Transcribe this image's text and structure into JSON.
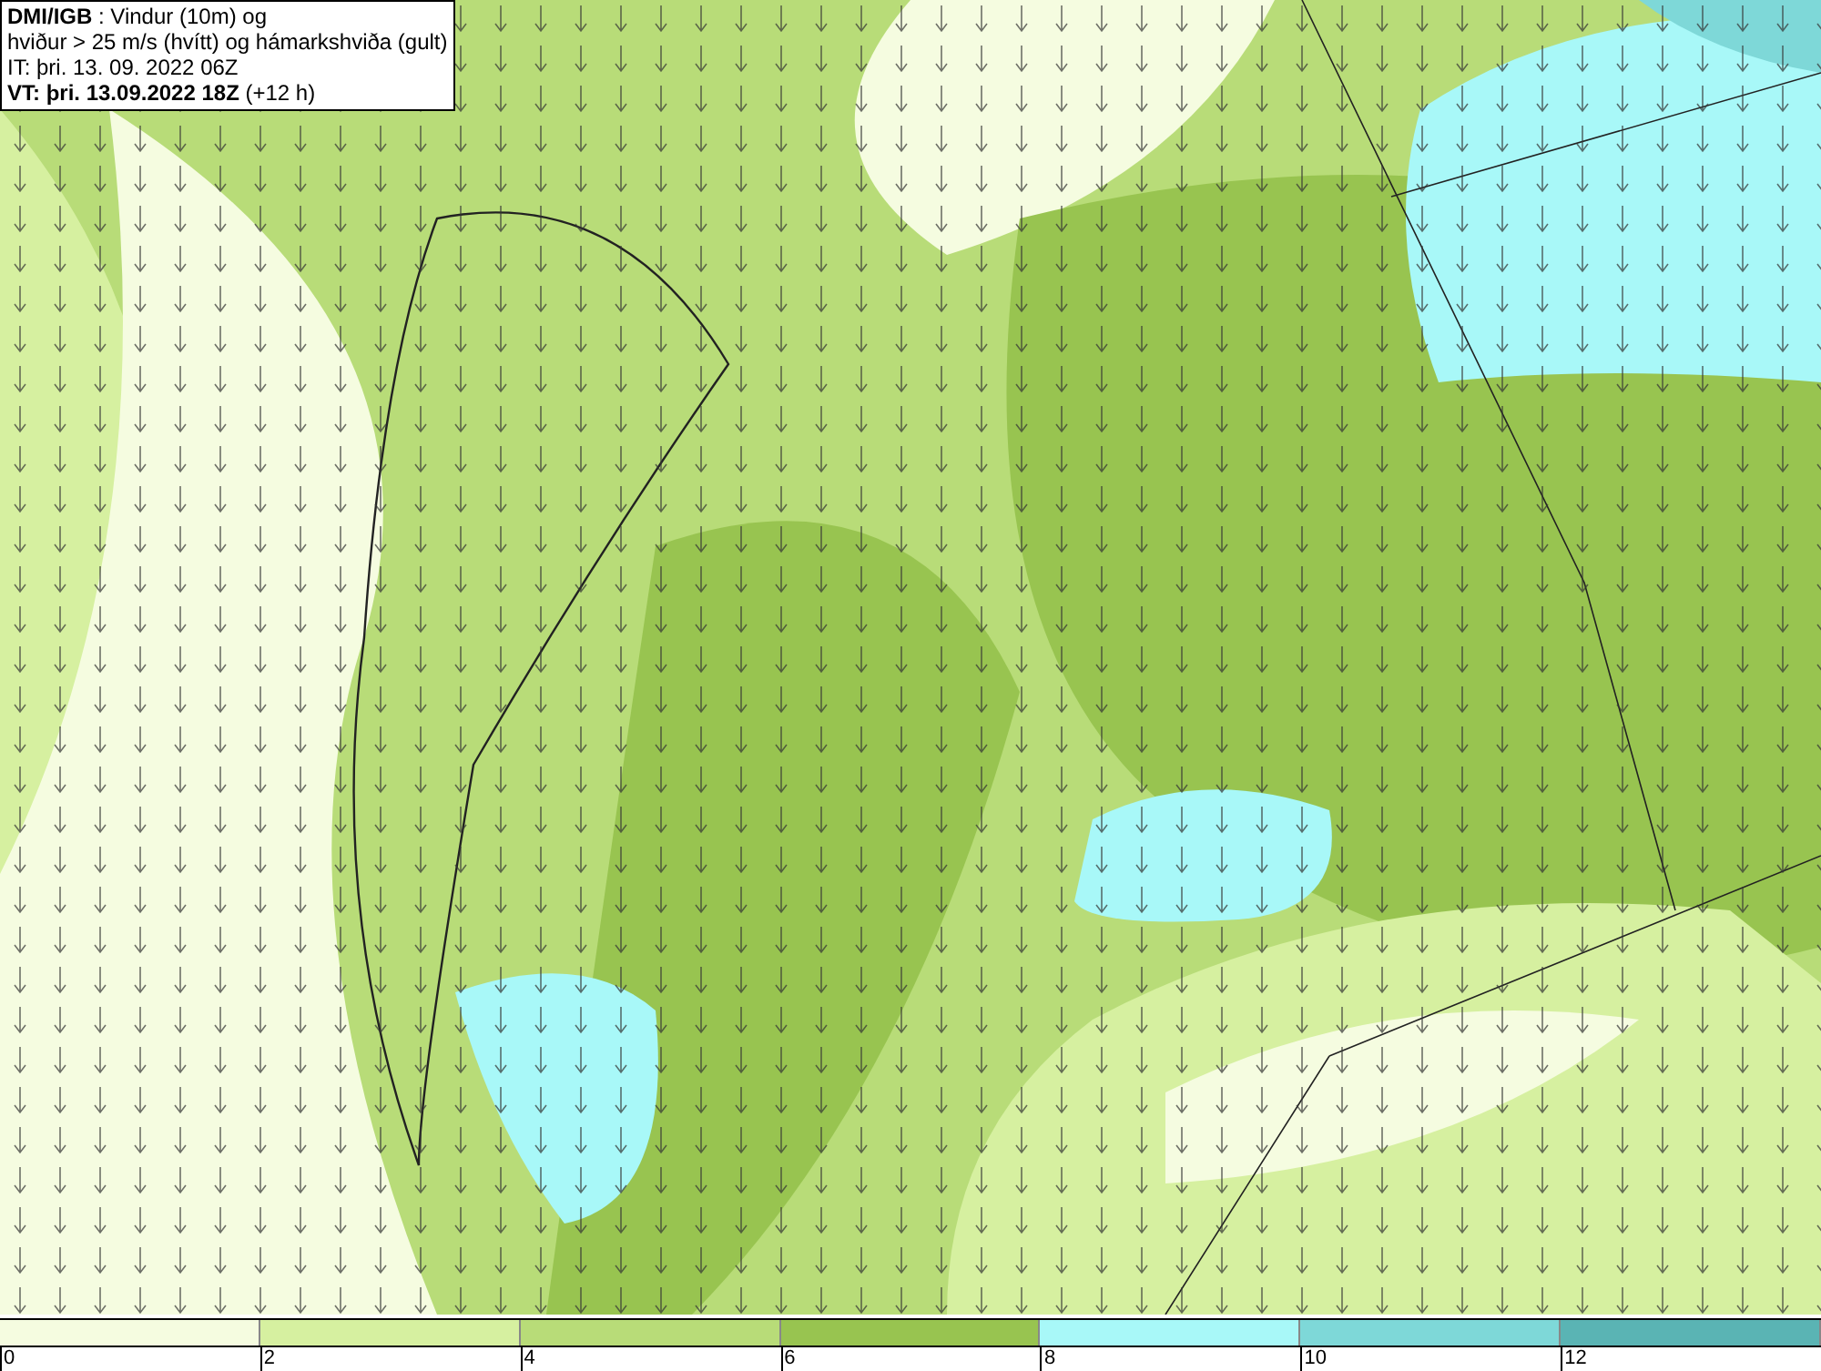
{
  "header": {
    "lines": [
      "**DMI/IGB** : Vindur (10m) og",
      "hviður > 25 m/s (hvítt) og hámarkshviða (gult)",
      "IT: þri. 13. 09. 2022 06Z",
      "**VT: þri. 13.09.2022 18Z** (+12 h)"
    ]
  },
  "legend": {
    "bins": [
      {
        "label": "0",
        "color": "#f5fce0"
      },
      {
        "label": "2",
        "color": "#d6f0a0"
      },
      {
        "label": "4",
        "color": "#b8dc78"
      },
      {
        "label": "6",
        "color": "#98c450"
      },
      {
        "label": "8",
        "color": "#a8f8f8"
      },
      {
        "label": "10",
        "color": "#7ed8d8"
      },
      {
        "label": "12",
        "color": "#5ab4b4"
      }
    ]
  }
}
